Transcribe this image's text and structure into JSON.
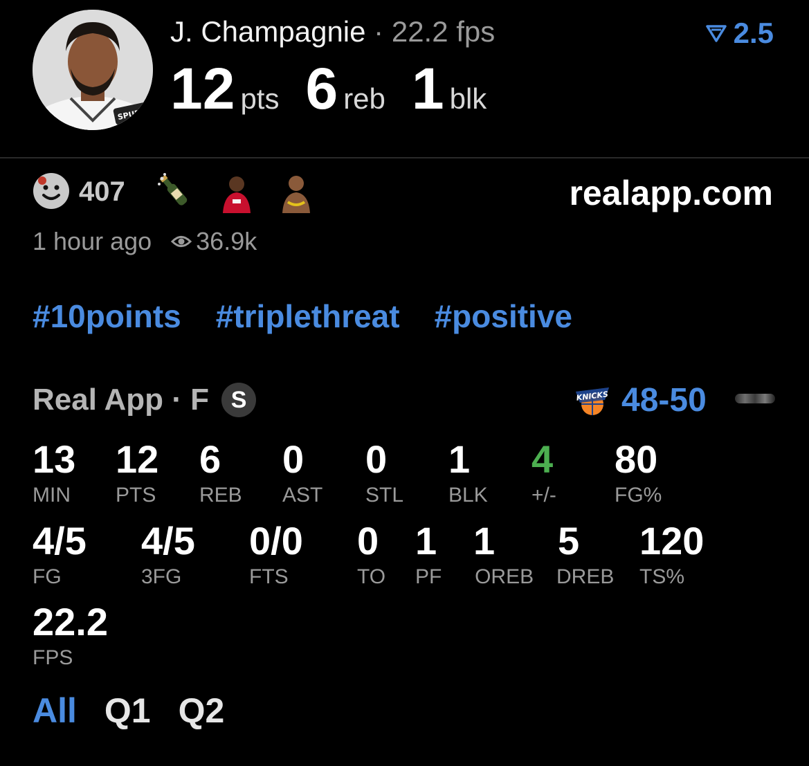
{
  "header": {
    "player_name": "J. Champagnie",
    "separator": "·",
    "fps_text": "22.2 fps",
    "rating_value": "2.5",
    "headline": [
      {
        "value": "12",
        "unit": "pts"
      },
      {
        "value": "6",
        "unit": "reb"
      },
      {
        "value": "1",
        "unit": "blk"
      }
    ]
  },
  "reactions": {
    "count": "407",
    "emojis": [
      "champagne-emoji",
      "player-emoji-1",
      "player-emoji-2"
    ],
    "site": "realapp.com",
    "time_ago": "1 hour ago",
    "views": "36.9k"
  },
  "tags": [
    "#10points",
    "#triplethreat",
    "#positive"
  ],
  "game": {
    "league_label": "Real App · F",
    "badge": "S",
    "opponent_logo": "knicks-logo",
    "score": "48-50"
  },
  "stats": {
    "row1": [
      {
        "value": "13",
        "label": "MIN"
      },
      {
        "value": "12",
        "label": "PTS"
      },
      {
        "value": "6",
        "label": "REB"
      },
      {
        "value": "0",
        "label": "AST"
      },
      {
        "value": "0",
        "label": "STL"
      },
      {
        "value": "1",
        "label": "BLK"
      },
      {
        "value": "4",
        "label": "+/-"
      },
      {
        "value": "80",
        "label": "FG%"
      }
    ],
    "row2": [
      {
        "value": "4/5",
        "label": "FG"
      },
      {
        "value": "4/5",
        "label": "3FG"
      },
      {
        "value": "0/0",
        "label": "FTS"
      },
      {
        "value": "0",
        "label": "TO"
      },
      {
        "value": "1",
        "label": "PF"
      },
      {
        "value": "1",
        "label": "OREB"
      },
      {
        "value": "5",
        "label": "DREB"
      },
      {
        "value": "120",
        "label": "TS%"
      }
    ],
    "row3": [
      {
        "value": "22.2",
        "label": "FPS"
      }
    ]
  },
  "periods": [
    {
      "label": "All",
      "active": true
    },
    {
      "label": "Q1",
      "active": false
    },
    {
      "label": "Q2",
      "active": false
    }
  ],
  "colors": {
    "accent": "#4a8be0",
    "positive": "#4caf50",
    "muted": "#9a9a9a",
    "background": "#000000"
  }
}
